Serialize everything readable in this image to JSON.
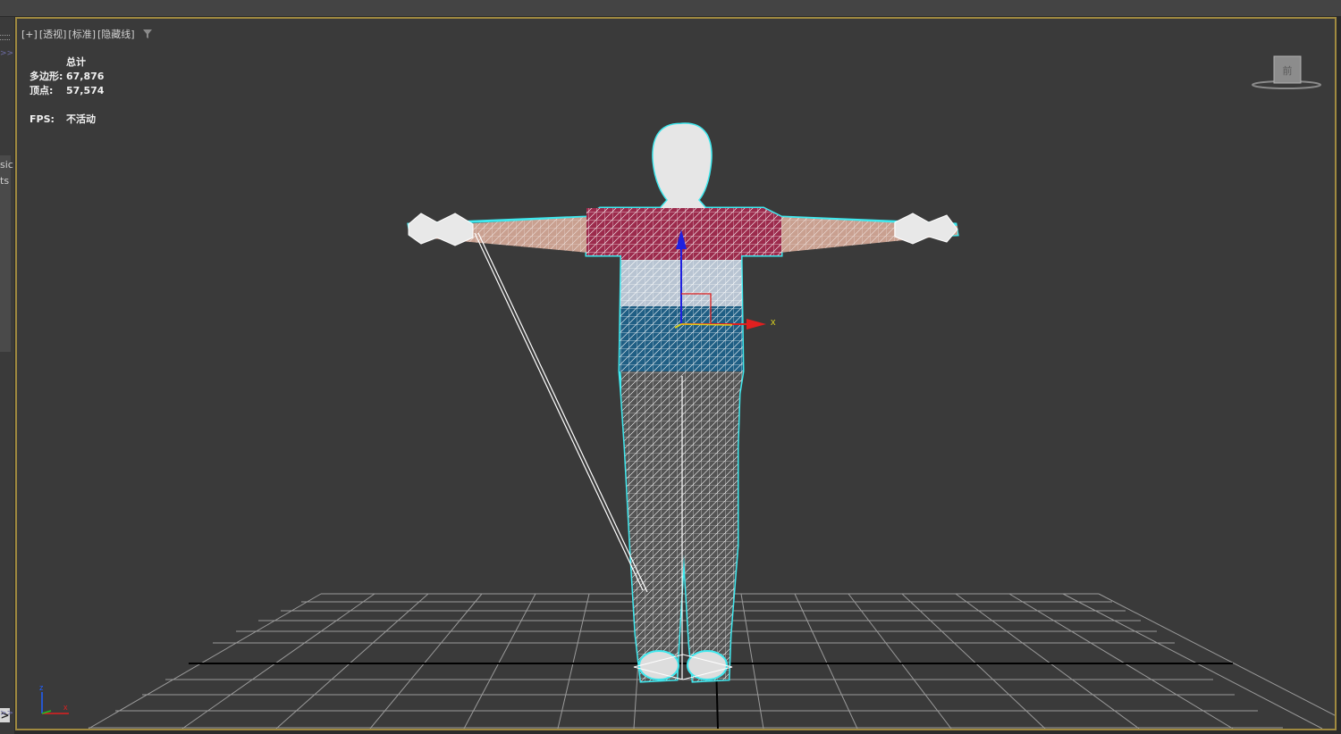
{
  "window": {
    "left_strip_fragments": [
      "sic",
      "ts"
    ],
    "left_strip_buttons": [
      ">>",
      ">>"
    ],
    "expand_arrow": ">"
  },
  "viewport": {
    "label_parts": [
      "[+]",
      "[透视]",
      "[标准]",
      "[隐藏线]"
    ],
    "filter_icon": "filter-funnel-icon",
    "stats": {
      "header": "总计",
      "polygons_label": "多边形:",
      "polygons_value": "67,876",
      "vertices_label": "顶点:",
      "vertices_value": "57,574",
      "fps_label": "FPS:",
      "fps_value": "不活动"
    },
    "gizmo_x_label": "x",
    "axis_tripod_labels": {
      "z": "z",
      "x": "x"
    },
    "viewcube_icon": "viewcube-home-icon",
    "viewcube_text": "前"
  },
  "colors": {
    "viewport_border": "#a08a40",
    "viewport_bg": "#3a3a3a",
    "selection_outline": "#3fe8ee",
    "shirt_top": "#9c2a4c",
    "shirt_mid": "#b8c4d2",
    "shirt_bottom": "#1f5e84",
    "skin": "#c9a090",
    "axis_x": "#e02020",
    "axis_y": "#d8d020",
    "axis_z": "#2020e0"
  }
}
